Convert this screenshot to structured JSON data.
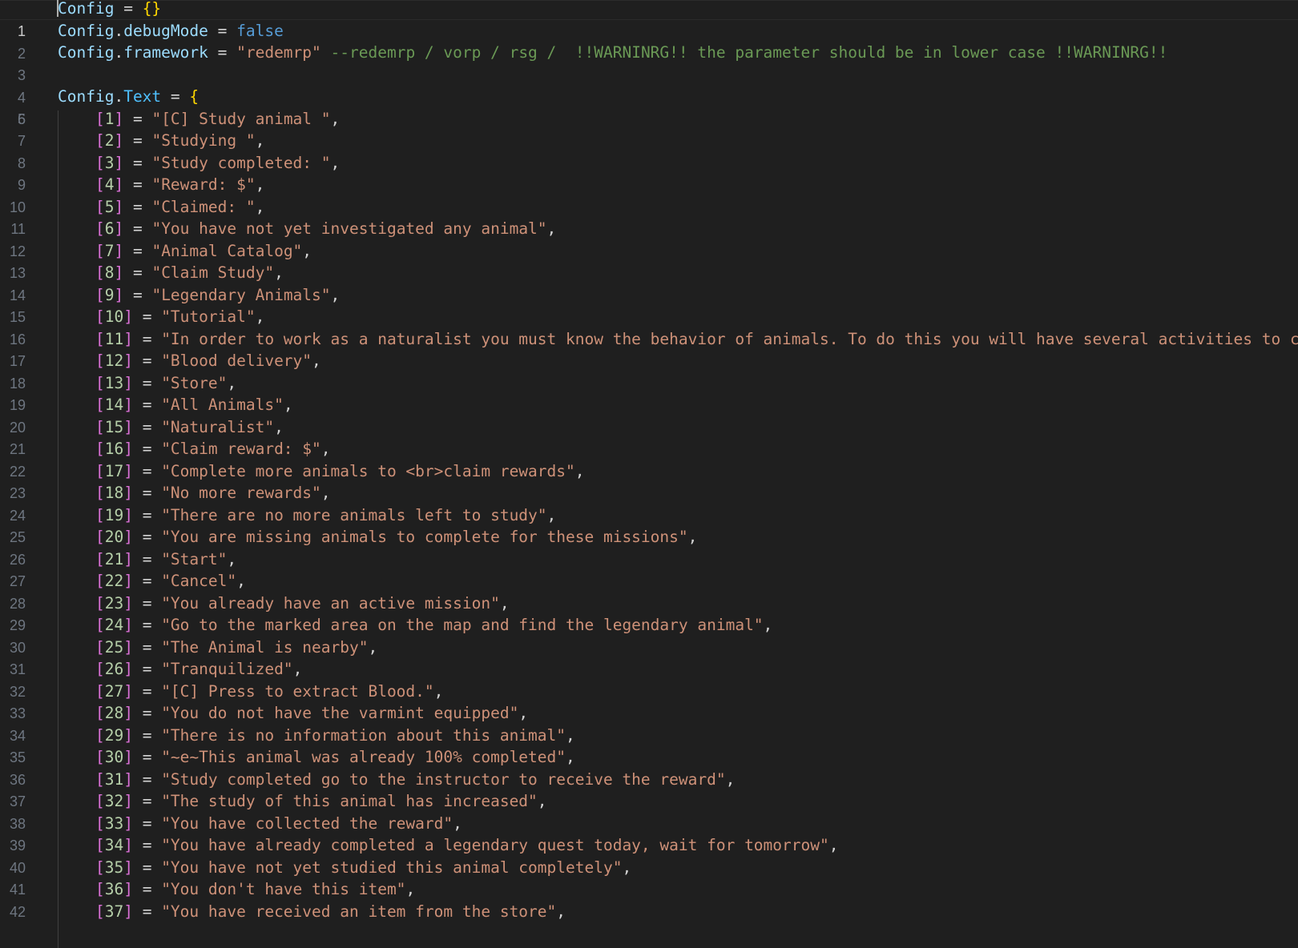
{
  "editor": {
    "line1": {
      "number": "1",
      "ident": "Config",
      "op": " = ",
      "braces": "{}"
    },
    "line2": {
      "number": "2",
      "ident": "Config",
      "dot": ".",
      "prop": "debugMode",
      "op": " = ",
      "value": "false"
    },
    "line3": {
      "number": "3",
      "ident": "Config",
      "dot": ".",
      "prop": "framework",
      "op": " = ",
      "value": "\"redemrp\"",
      "comment": " --redemrp / vorp / rsg /  !!WARNINRG!! the parameter should be in lower case !!WARNINRG!!"
    },
    "line4": {
      "number": "4"
    },
    "line5": {
      "number": "5",
      "ident": "Config",
      "dot": ".",
      "prop": "Text",
      "op": " = ",
      "brace": "{"
    },
    "entries": [
      {
        "number": "6",
        "key": "1",
        "value": "\"[C] Study animal \""
      },
      {
        "number": "7",
        "key": "2",
        "value": "\"Studying \""
      },
      {
        "number": "8",
        "key": "3",
        "value": "\"Study completed: \""
      },
      {
        "number": "9",
        "key": "4",
        "value": "\"Reward: $\""
      },
      {
        "number": "10",
        "key": "5",
        "value": "\"Claimed: \""
      },
      {
        "number": "11",
        "key": "6",
        "value": "\"You have not yet investigated any animal\""
      },
      {
        "number": "12",
        "key": "7",
        "value": "\"Animal Catalog\""
      },
      {
        "number": "13",
        "key": "8",
        "value": "\"Claim Study\""
      },
      {
        "number": "14",
        "key": "9",
        "value": "\"Legendary Animals\""
      },
      {
        "number": "15",
        "key": "10",
        "value": "\"Tutorial\""
      },
      {
        "number": "16",
        "key": "11",
        "value": "\"In order to work as a naturalist you must know the behavior of animals. To do this you will have several activities to com"
      },
      {
        "number": "17",
        "key": "12",
        "value": "\"Blood delivery\""
      },
      {
        "number": "18",
        "key": "13",
        "value": "\"Store\""
      },
      {
        "number": "19",
        "key": "14",
        "value": "\"All Animals\""
      },
      {
        "number": "20",
        "key": "15",
        "value": "\"Naturalist\""
      },
      {
        "number": "21",
        "key": "16",
        "value": "\"Claim reward: $\""
      },
      {
        "number": "22",
        "key": "17",
        "value": "\"Complete more animals to <br>claim rewards\""
      },
      {
        "number": "23",
        "key": "18",
        "value": "\"No more rewards\""
      },
      {
        "number": "24",
        "key": "19",
        "value": "\"There are no more animals left to study\""
      },
      {
        "number": "25",
        "key": "20",
        "value": "\"You are missing animals to complete for these missions\""
      },
      {
        "number": "26",
        "key": "21",
        "value": "\"Start\""
      },
      {
        "number": "27",
        "key": "22",
        "value": "\"Cancel\""
      },
      {
        "number": "28",
        "key": "23",
        "value": "\"You already have an active mission\""
      },
      {
        "number": "29",
        "key": "24",
        "value": "\"Go to the marked area on the map and find the legendary animal\""
      },
      {
        "number": "30",
        "key": "25",
        "value": "\"The Animal is nearby\""
      },
      {
        "number": "31",
        "key": "26",
        "value": "\"Tranquilized\""
      },
      {
        "number": "32",
        "key": "27",
        "value": "\"[C] Press to extract Blood.\""
      },
      {
        "number": "33",
        "key": "28",
        "value": "\"You do not have the varmint equipped\""
      },
      {
        "number": "34",
        "key": "29",
        "value": "\"There is no information about this animal\""
      },
      {
        "number": "35",
        "key": "30",
        "value": "\"~e~This animal was already 100% completed\""
      },
      {
        "number": "36",
        "key": "31",
        "value": "\"Study completed go to the instructor to receive the reward\""
      },
      {
        "number": "37",
        "key": "32",
        "value": "\"The study of this animal has increased\""
      },
      {
        "number": "38",
        "key": "33",
        "value": "\"You have collected the reward\""
      },
      {
        "number": "39",
        "key": "34",
        "value": "\"You have already completed a legendary quest today, wait for tomorrow\""
      },
      {
        "number": "40",
        "key": "35",
        "value": "\"You have not yet studied this animal completely\""
      },
      {
        "number": "41",
        "key": "36",
        "value": "\"You don't have this item\""
      },
      {
        "number": "42",
        "key": "37",
        "value": "\"You have received an item from the store\""
      }
    ],
    "colors": {
      "background": "#1f1f1f",
      "identifier": "#9cdcfe",
      "property": "#4fc1ff",
      "keyword_bool": "#569cd6",
      "string": "#ce9178",
      "comment": "#6a9955",
      "brace": "#ffd700",
      "bracket": "#da70d6",
      "line_number": "#6e7681"
    }
  }
}
